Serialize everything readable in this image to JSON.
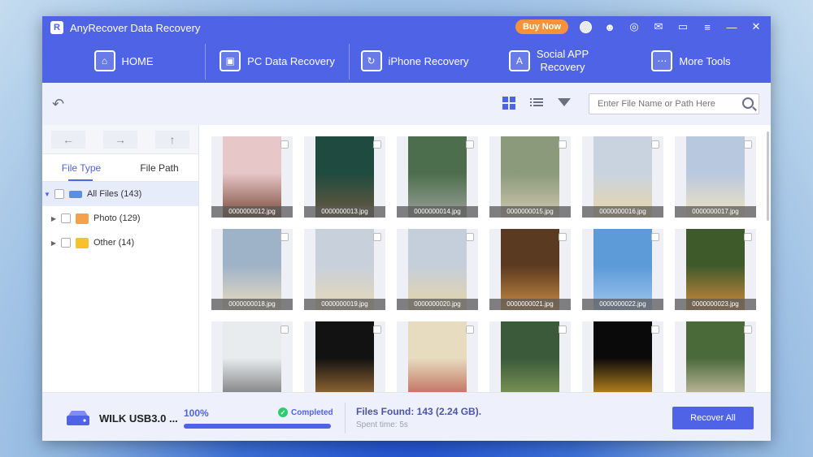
{
  "app": {
    "title": "AnyRecover Data Recovery",
    "logo_letter": "R"
  },
  "titlebar": {
    "buy_now": "Buy Now"
  },
  "nav": [
    {
      "label": "HOME",
      "icon": "home-icon"
    },
    {
      "label": "PC Data Recovery",
      "icon": "pc-recovery-icon"
    },
    {
      "label": "iPhone Recovery",
      "icon": "iphone-recovery-icon"
    },
    {
      "label_line1": "Social APP",
      "label_line2": "Recovery",
      "icon": "social-app-icon"
    },
    {
      "label": "More Tools",
      "icon": "more-tools-icon"
    }
  ],
  "search": {
    "placeholder": "Enter File Name or Path Here"
  },
  "sidebar": {
    "tabs": [
      "File Type",
      "File Path"
    ],
    "tree": [
      {
        "label": "All Files (143)",
        "icon": "drive-icon"
      },
      {
        "label": "Photo (129)",
        "icon": "photo-folder-icon"
      },
      {
        "label": "Other (14)",
        "icon": "folder-icon"
      }
    ]
  },
  "files": [
    {
      "name": "0000000012.jpg",
      "colors": [
        "#e8c7c9",
        "#7a4a38"
      ]
    },
    {
      "name": "0000000013.jpg",
      "colors": [
        "#1f4a3f",
        "#6b5a3e"
      ]
    },
    {
      "name": "0000000014.jpg",
      "colors": [
        "#4c6e4c",
        "#9aa09a"
      ]
    },
    {
      "name": "0000000015.jpg",
      "colors": [
        "#8a9a7a",
        "#cfc7b0"
      ]
    },
    {
      "name": "0000000016.jpg",
      "colors": [
        "#c9d3e0",
        "#e8d6a8"
      ]
    },
    {
      "name": "0000000017.jpg",
      "colors": [
        "#b8c8de",
        "#efe3c2"
      ]
    },
    {
      "name": "0000000018.jpg",
      "colors": [
        "#9fb3c8",
        "#e9dcc0"
      ]
    },
    {
      "name": "0000000019.jpg",
      "colors": [
        "#c8d0db",
        "#e7d9b5"
      ]
    },
    {
      "name": "0000000020.jpg",
      "colors": [
        "#c5cfdb",
        "#e6d3a6"
      ]
    },
    {
      "name": "0000000021.jpg",
      "colors": [
        "#5a3a20",
        "#c98a45"
      ]
    },
    {
      "name": "0000000022.jpg",
      "colors": [
        "#5c9ad8",
        "#9fc5ee"
      ]
    },
    {
      "name": "0000000023.jpg",
      "colors": [
        "#3f5a2a",
        "#d08a3c"
      ]
    },
    {
      "name": "",
      "colors": [
        "#e8ecef",
        "#6a6a6a"
      ]
    },
    {
      "name": "",
      "colors": [
        "#121212",
        "#b07a3a"
      ]
    },
    {
      "name": "",
      "colors": [
        "#e8dcc0",
        "#b85a4a"
      ]
    },
    {
      "name": "",
      "colors": [
        "#3a5a3a",
        "#8aa05a"
      ]
    },
    {
      "name": "",
      "colors": [
        "#0a0a0a",
        "#e0a020"
      ]
    },
    {
      "name": "",
      "colors": [
        "#4a6a3a",
        "#d8c8b0"
      ]
    }
  ],
  "footer": {
    "drive_name": "WILK USB3.0 ...",
    "progress_text": "100%",
    "progress_value": 1.0,
    "status": "Completed",
    "files_found": "Files Found: 143 (2.24 GB).",
    "spent_time": "Spent time: 5s",
    "recover_all": "Recover All"
  },
  "colors": {
    "accent": "#4f63e6",
    "buy": "#f7923a",
    "success": "#2ecc71"
  }
}
